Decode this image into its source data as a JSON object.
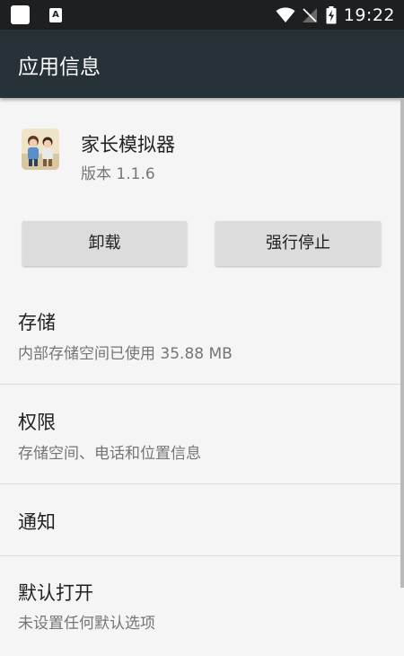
{
  "status_bar": {
    "time": "19:22",
    "notification_a": "A",
    "icons": [
      "app-notification-icon",
      "a-notification-icon",
      "wifi-icon",
      "no-signal-icon",
      "battery-charging-icon"
    ]
  },
  "app_bar": {
    "title": "应用信息"
  },
  "app": {
    "name": "家长模拟器",
    "version": "版本 1.1.6",
    "icon": "app-icon"
  },
  "buttons": {
    "uninstall": "卸载",
    "force_stop": "强行停止"
  },
  "prefs": {
    "storage": {
      "title": "存储",
      "summary": "内部存储空间已使用 35.88 MB"
    },
    "permissions": {
      "title": "权限",
      "summary": "存储空间、电话和位置信息"
    },
    "notifications": {
      "title": "通知"
    },
    "open_by_default": {
      "title": "默认打开",
      "summary": "未设置任何默认选项"
    }
  },
  "colors": {
    "status_bar_bg": "#1e1f21",
    "app_bar_bg": "#263238",
    "page_bg": "#f5f5f5",
    "button_bg": "#dcdcdc",
    "primary_text": "#212121",
    "secondary_text": "#757575"
  }
}
